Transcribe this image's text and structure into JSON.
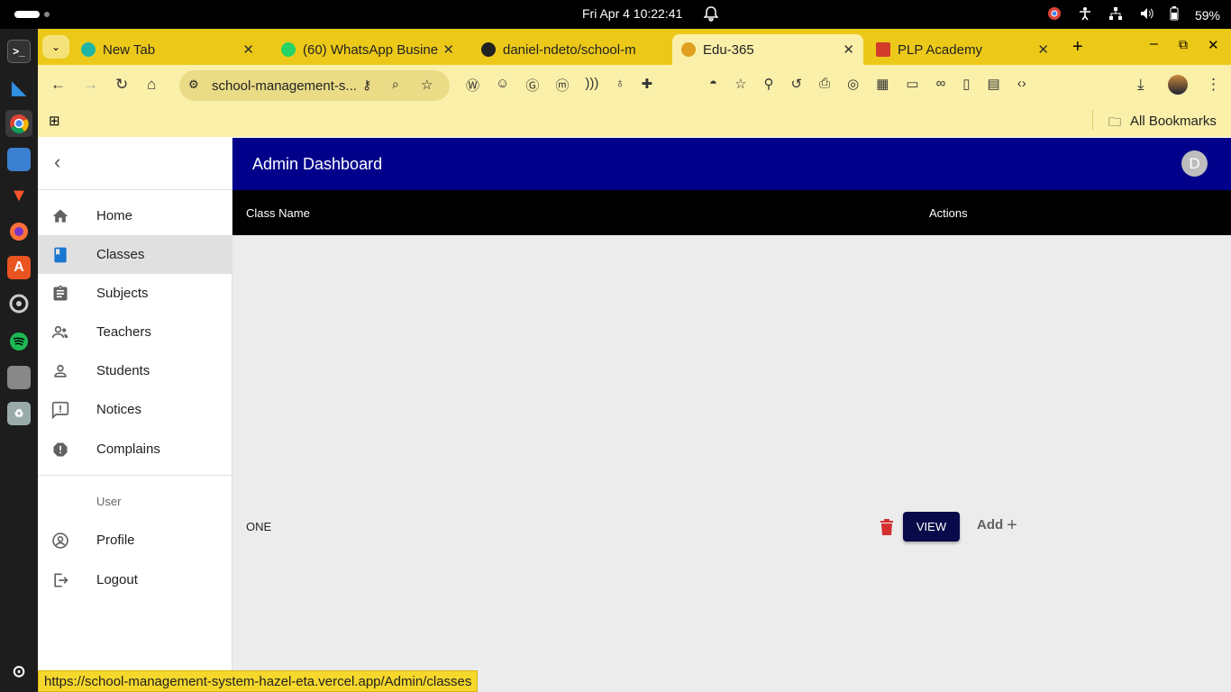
{
  "system": {
    "clock": "Fri Apr 4  10:22:41",
    "battery": "59%"
  },
  "tabs": [
    {
      "label": "New Tab",
      "color": "#1fb5a5"
    },
    {
      "label": "(60) WhatsApp Busine",
      "color": "#25d366"
    },
    {
      "label": "daniel-ndeto/school-m",
      "color": "#222222"
    },
    {
      "label": "Edu-365",
      "color": "#e0a020"
    },
    {
      "label": "PLP Academy",
      "color": "#d23a2a"
    }
  ],
  "omnibox": {
    "url": "school-management-s..."
  },
  "bookmarks": {
    "all_label": "All Bookmarks"
  },
  "app": {
    "title": "Admin Dashboard",
    "avatar_letter": "D",
    "nav": {
      "home": "Home",
      "classes": "Classes",
      "subjects": "Subjects",
      "teachers": "Teachers",
      "students": "Students",
      "notices": "Notices",
      "complains": "Complains",
      "user_header": "User",
      "profile": "Profile",
      "logout": "Logout"
    },
    "table": {
      "col_class_name": "Class Name",
      "col_actions": "Actions",
      "rows": [
        {
          "class_name": "ONE",
          "view_label": "VIEW",
          "add_label": "Add"
        }
      ]
    }
  },
  "status_url": "https://school-management-system-hazel-eta.vercel.app/Admin/classes",
  "colors": {
    "appbar": "#00008b",
    "view_button": "#080a4a",
    "delete_icon": "#d32f2f",
    "tabstrip": "#ecc919"
  }
}
